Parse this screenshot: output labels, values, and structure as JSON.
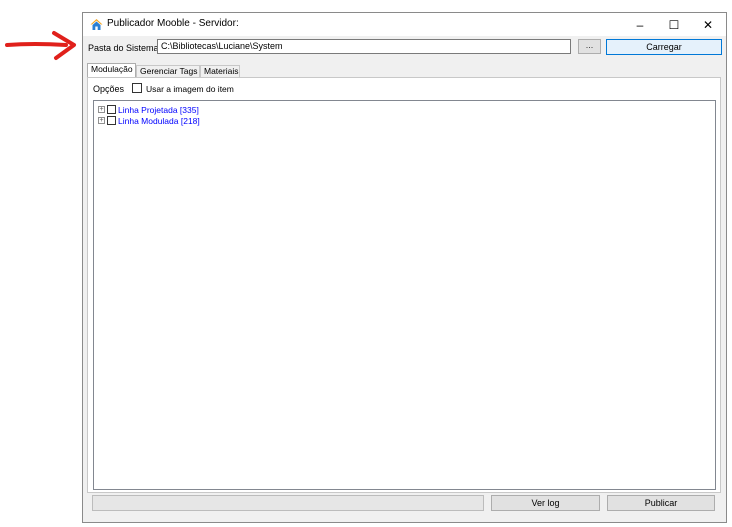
{
  "window": {
    "title": "Publicador Mooble - Servidor:",
    "controls": {
      "minimize": "–",
      "maximize": "☐",
      "close": "✕"
    },
    "app_icon": "house-icon"
  },
  "path_row": {
    "label": "Pasta do Sistema:",
    "value": "C:\\Bibliotecas\\Luciane\\System",
    "browse_label": "...",
    "load_label": "Carregar"
  },
  "tabs": [
    {
      "label": "Modulação",
      "active": true
    },
    {
      "label": "Gerenciar Tags",
      "active": false
    },
    {
      "label": "Materiais",
      "active": false
    }
  ],
  "options": {
    "label": "Opções",
    "checkbox_label": "Usar a imagem do item",
    "checked": false
  },
  "tree": {
    "items": [
      {
        "expander": "+",
        "label": "Linha Projetada [335]",
        "checked": false
      },
      {
        "expander": "+",
        "label": "Linha Modulada [218]",
        "checked": false
      }
    ]
  },
  "footer": {
    "verlog_label": "Ver log",
    "publicar_label": "Publicar"
  },
  "colors": {
    "annotation_arrow": "#e0201b",
    "tree_text": "#0000ff",
    "primary_border": "#0078d7"
  }
}
